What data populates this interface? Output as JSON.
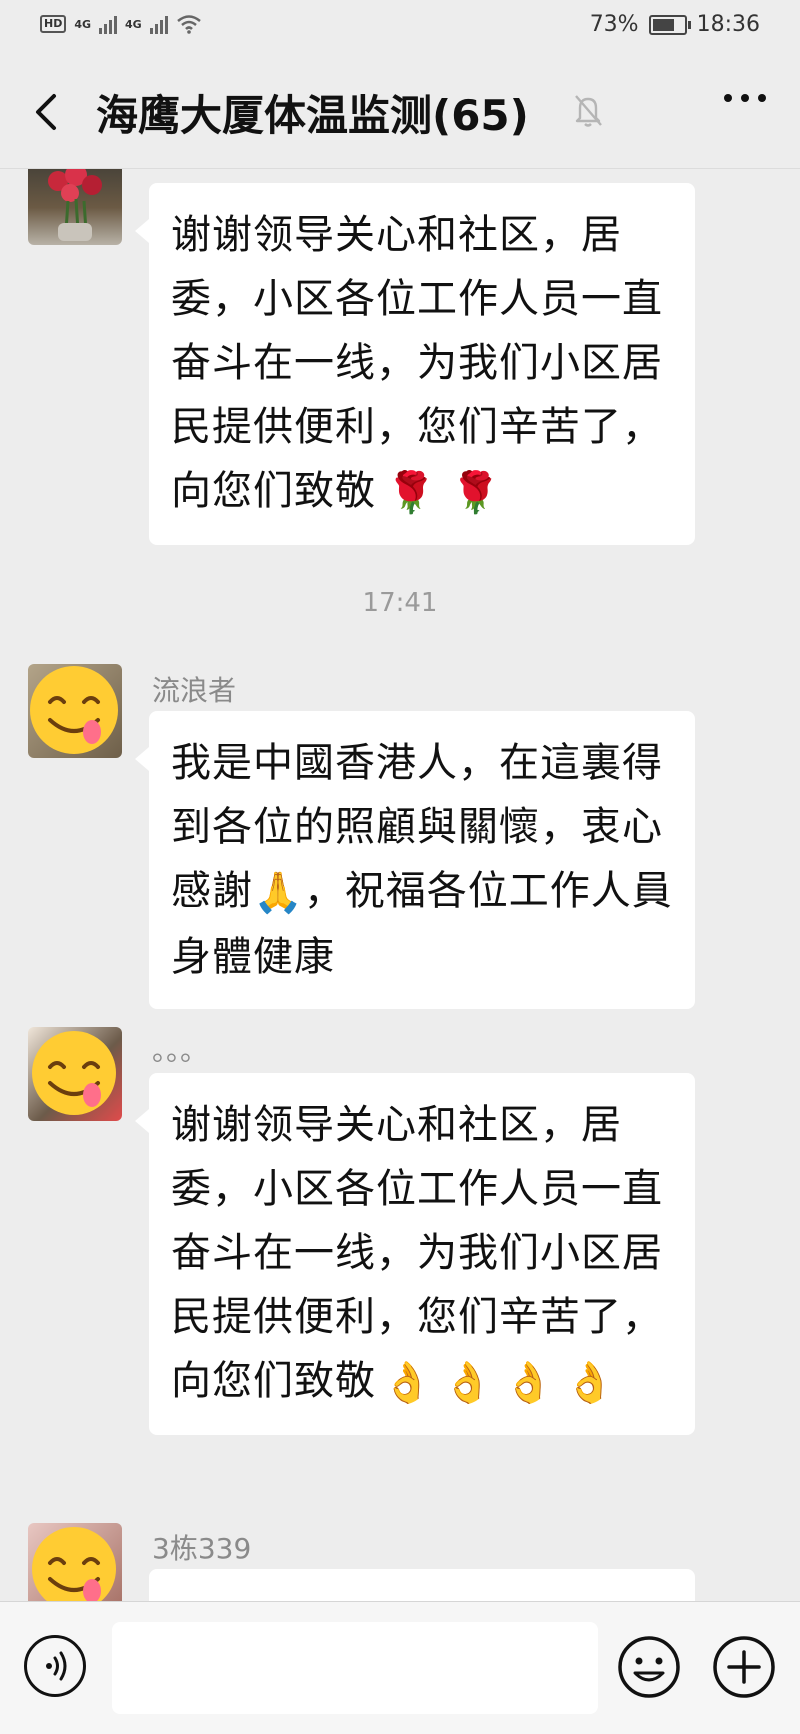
{
  "status_bar": {
    "hd_label": "HD",
    "network_1": "4G",
    "network_2": "4G",
    "battery_percent": "73%",
    "battery_level": 0.73,
    "time": "18:36"
  },
  "header": {
    "title": "海鹰大厦体温监测(65)",
    "muted": true
  },
  "messages": [
    {
      "sender": "",
      "avatar": "flower-photo",
      "text": "谢谢领导关心和社区，居委，小区各位工作人员一直奋斗在一线，为我们小区居民提供便利，您们辛苦了，向您们致敬",
      "emojis": [
        "🌹",
        "🌹"
      ]
    },
    {
      "type": "time",
      "text": "17:41"
    },
    {
      "sender": "流浪者",
      "avatar": "smiley-photo",
      "text_part1": "我是中國香港人，在這裏得到各位的照顧與關懷，衷心感謝",
      "inline_emoji": "🙏",
      "text_part2": "，祝福各位工作人員身體健康"
    },
    {
      "sender": "。。。",
      "avatar": "smiley-photo-2",
      "text": "谢谢领导关心和社区，居委，小区各位工作人员一直奋斗在一线，为我们小区居民提供便利，您们辛苦了，向您们致敬",
      "emojis": [
        "👌",
        "👌",
        "👌",
        "👌"
      ]
    },
    {
      "sender": "3栋339",
      "avatar": "smiley-photo-3",
      "text": ""
    }
  ],
  "input_bar": {
    "placeholder": "",
    "icons": [
      "voice-icon",
      "emoji-face-icon",
      "plus-icon"
    ]
  },
  "colors": {
    "background": "#ededed",
    "bubble": "#ffffff",
    "sender_name": "#8a8a8a",
    "timestamp": "#9a9a9a"
  }
}
